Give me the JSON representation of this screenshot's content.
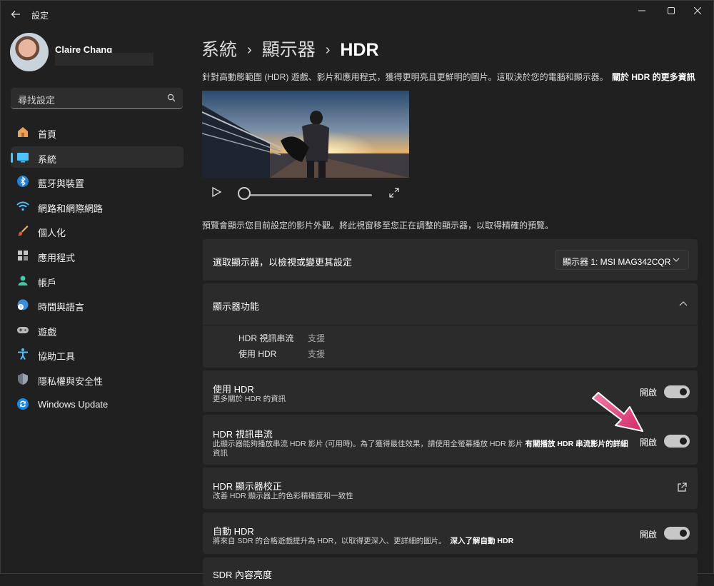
{
  "window": {
    "app_title": "設定",
    "controls": [
      "minimize",
      "maximize",
      "close"
    ]
  },
  "profile": {
    "name": "Claire Chang"
  },
  "search": {
    "placeholder": "尋找設定"
  },
  "sidebar": {
    "items": [
      {
        "label": "首頁",
        "icon": "home-icon"
      },
      {
        "label": "系統",
        "icon": "system-icon",
        "active": true
      },
      {
        "label": "藍牙與裝置",
        "icon": "bluetooth-icon"
      },
      {
        "label": "網路和網際網路",
        "icon": "wifi-icon"
      },
      {
        "label": "個人化",
        "icon": "brush-icon"
      },
      {
        "label": "應用程式",
        "icon": "apps-icon"
      },
      {
        "label": "帳戶",
        "icon": "account-icon"
      },
      {
        "label": "時間與語言",
        "icon": "time-language-icon"
      },
      {
        "label": "遊戲",
        "icon": "gamepad-icon"
      },
      {
        "label": "協助工具",
        "icon": "accessibility-icon"
      },
      {
        "label": "隱私權與安全性",
        "icon": "shield-icon"
      },
      {
        "label": "Windows Update",
        "icon": "windows-update-icon"
      }
    ]
  },
  "breadcrumb": {
    "level1": "系統",
    "level2": "顯示器",
    "current": "HDR",
    "separator": "›"
  },
  "intro": {
    "text": "針對高動態範圍 (HDR) 遊戲、影片和應用程式，獲得更明亮且更鮮明的圖片。這取決於您的電腦和顯示器。",
    "link": "關於 HDR 的更多資訊"
  },
  "video": {
    "progress": 0
  },
  "preview_note": "預覽會顯示您目前設定的影片外觀。將此視窗移至您正在調整的顯示器，以取得精確的預覽。",
  "display_select": {
    "label": "選取顯示器，以檢視或變更其設定",
    "value": "顯示器 1: MSI MAG342CQR"
  },
  "capabilities": {
    "title": "顯示器功能",
    "rows": [
      {
        "name": "HDR 視訊串流",
        "value": "支援"
      },
      {
        "name": "使用 HDR",
        "value": "支援"
      }
    ]
  },
  "use_hdr": {
    "title": "使用 HDR",
    "subtitle": "更多關於 HDR 的資訊",
    "state": "開啟"
  },
  "hdr_streaming": {
    "title": "HDR 視訊串流",
    "subtitle": "此顯示器能夠播放串流 HDR 影片 (可用時)。為了獲得最佳效果，請使用全螢幕播放 HDR 影片",
    "link_line1": "有關播放 HDR 串流影片的詳細",
    "link_line2": "資訊",
    "state": "開啟"
  },
  "hdr_calibration": {
    "title": "HDR 顯示器校正",
    "subtitle": "改善 HDR 顯示器上的色彩精確度和一致性"
  },
  "auto_hdr": {
    "title": "自動 HDR",
    "subtitle": "將來自 SDR 的合格遊戲提升為 HDR，以取得更深入、更詳細的圖片。",
    "link": "深入了解自動 HDR",
    "state": "開啟"
  },
  "sdr_brightness": {
    "title": "SDR 內容亮度"
  },
  "colors": {
    "accent": "#4cc2ff",
    "annotation_arrow": "#e0407a"
  }
}
